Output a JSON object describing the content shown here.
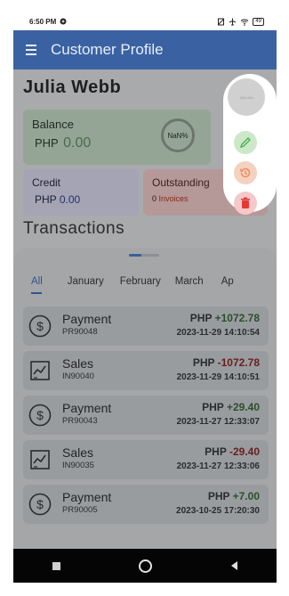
{
  "status_bar": {
    "time": "6:50 PM",
    "battery": "49"
  },
  "app_bar": {
    "title": "Customer Profile"
  },
  "customer": {
    "name": "Julia Webb"
  },
  "balance": {
    "label": "Balance",
    "currency": "PHP",
    "amount": "0.00",
    "percent": "NaN%"
  },
  "credit": {
    "label": "Credit",
    "currency": "PHP",
    "amount": "0.00"
  },
  "outstanding": {
    "label": "Outstanding",
    "count": "0",
    "unit": "Invoices"
  },
  "transactions": {
    "heading": "Transactions",
    "tabs": [
      "All",
      "January",
      "February",
      "March",
      "Ap"
    ],
    "active_tab": "All",
    "rows": [
      {
        "type": "Payment",
        "id": "PR90048",
        "currency": "PHP",
        "amount": "+1072.78",
        "date": "2023-11-29 14:10:54",
        "icon": "dollar-icon",
        "sign": "pos"
      },
      {
        "type": "Sales",
        "id": "IN90040",
        "currency": "PHP",
        "amount": "-1072.78",
        "date": "2023-11-29 14:10:51",
        "icon": "chart-icon",
        "sign": "neg"
      },
      {
        "type": "Payment",
        "id": "PR90043",
        "currency": "PHP",
        "amount": "+29.40",
        "date": "2023-11-27 12:33:07",
        "icon": "dollar-icon",
        "sign": "pos"
      },
      {
        "type": "Sales",
        "id": "IN90035",
        "currency": "PHP",
        "amount": "-29.40",
        "date": "2023-11-27 12:33:06",
        "icon": "chart-icon",
        "sign": "neg"
      },
      {
        "type": "Payment",
        "id": "PR90005",
        "currency": "PHP",
        "amount": "+7.00",
        "date": "2023-10-25 17:20:30",
        "icon": "dollar-icon",
        "sign": "pos"
      }
    ]
  },
  "fab_menu": {
    "avatar_text": "184×184",
    "actions": [
      "edit-icon",
      "history-icon",
      "delete-icon"
    ],
    "colors": {
      "edit": "#4caf50",
      "history": "#f08a50",
      "delete": "#e53935"
    }
  }
}
